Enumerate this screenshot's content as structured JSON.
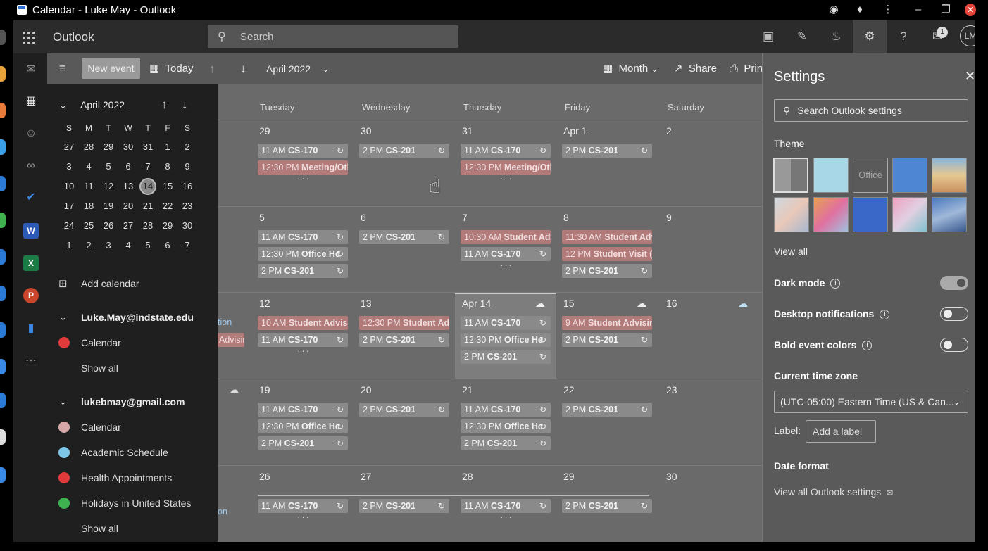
{
  "window": {
    "title": "Calendar - Luke May - Outlook"
  },
  "app": {
    "name": "Outlook"
  },
  "search": {
    "placeholder": "Search"
  },
  "profile": {
    "initials": "LM",
    "notification_count": "1"
  },
  "command_bar": {
    "new_event": "New event",
    "today": "Today",
    "current_period": "April 2022",
    "view": "Month",
    "share": "Share",
    "print": "Print"
  },
  "mini_calendar": {
    "month_label": "April 2022",
    "weekdays": [
      "S",
      "M",
      "T",
      "W",
      "T",
      "F",
      "S"
    ],
    "weeks": [
      [
        "27",
        "28",
        "29",
        "30",
        "31",
        "1",
        "2"
      ],
      [
        "3",
        "4",
        "5",
        "6",
        "7",
        "8",
        "9"
      ],
      [
        "10",
        "11",
        "12",
        "13",
        "14",
        "15",
        "16"
      ],
      [
        "17",
        "18",
        "19",
        "20",
        "21",
        "22",
        "23"
      ],
      [
        "24",
        "25",
        "26",
        "27",
        "28",
        "29",
        "30"
      ],
      [
        "1",
        "2",
        "3",
        "4",
        "5",
        "6",
        "7"
      ]
    ],
    "selected_day": "14"
  },
  "sidebar": {
    "add_calendar": "Add calendar",
    "groups": [
      {
        "account": "Luke.May@indstate.edu",
        "calendars": [
          {
            "name": "Calendar",
            "color": "#e03a3a"
          }
        ],
        "show_all": "Show all"
      },
      {
        "account": "lukebmay@gmail.com",
        "calendars": [
          {
            "name": "Calendar",
            "color": "#d8a8a8"
          },
          {
            "name": "Academic Schedule",
            "color": "#7fc7e8"
          },
          {
            "name": "Health Appointments",
            "color": "#e03a3a"
          },
          {
            "name": "Holidays in United States",
            "color": "#3fb24f"
          }
        ],
        "show_all": "Show all"
      }
    ]
  },
  "calendar": {
    "weekdays": [
      "Tuesday",
      "Wednesday",
      "Thursday",
      "Friday",
      "Saturday"
    ],
    "weeks": [
      {
        "days": [
          {
            "label": "29",
            "events": [
              {
                "t": "11 AM",
                "n": "CS-170",
                "c": "g",
                "r": true
              },
              {
                "t": "12:30 PM",
                "n": "Meeting/Oth",
                "c": "r",
                "r": false
              }
            ],
            "more": true
          },
          {
            "label": "30",
            "events": [
              {
                "t": "2 PM",
                "n": "CS-201",
                "c": "g",
                "r": true
              }
            ],
            "more": false
          },
          {
            "label": "31",
            "events": [
              {
                "t": "11 AM",
                "n": "CS-170",
                "c": "g",
                "r": true
              },
              {
                "t": "12:30 PM",
                "n": "Meeting/Oth",
                "c": "r",
                "r": false
              }
            ],
            "more": true
          },
          {
            "label": "Apr 1",
            "events": [
              {
                "t": "2 PM",
                "n": "CS-201",
                "c": "g",
                "r": true
              }
            ],
            "more": false
          },
          {
            "label": "2",
            "events": [],
            "more": false
          }
        ]
      },
      {
        "days": [
          {
            "label": "5",
            "events": [
              {
                "t": "11 AM",
                "n": "CS-170",
                "c": "g",
                "r": true
              },
              {
                "t": "12:30 PM",
                "n": "Office Hc",
                "c": "g",
                "r": true
              },
              {
                "t": "2 PM",
                "n": "CS-201",
                "c": "g",
                "r": true
              }
            ],
            "more": false
          },
          {
            "label": "6",
            "events": [
              {
                "t": "2 PM",
                "n": "CS-201",
                "c": "g",
                "r": true
              }
            ],
            "more": false
          },
          {
            "label": "7",
            "events": [
              {
                "t": "10:30 AM",
                "n": "Student Adv",
                "c": "r",
                "r": false
              },
              {
                "t": "11 AM",
                "n": "CS-170",
                "c": "g",
                "r": true
              }
            ],
            "more": true
          },
          {
            "label": "8",
            "events": [
              {
                "t": "11:30 AM",
                "n": "Student Adv",
                "c": "r",
                "r": false
              },
              {
                "t": "12 PM",
                "n": "Student Visit (N",
                "c": "r",
                "r": false
              },
              {
                "t": "2 PM",
                "n": "CS-201",
                "c": "g",
                "r": true
              }
            ],
            "more": false
          },
          {
            "label": "9",
            "events": [],
            "more": false
          }
        ]
      },
      {
        "days": [
          {
            "label": "12",
            "events": [
              {
                "t": "10 AM",
                "n": "Student Advisir",
                "c": "r",
                "r": false
              },
              {
                "t": "11 AM",
                "n": "CS-170",
                "c": "g",
                "r": true
              }
            ],
            "more": true
          },
          {
            "label": "13",
            "events": [
              {
                "t": "12:30 PM",
                "n": "Student Adv",
                "c": "r",
                "r": false
              },
              {
                "t": "2 PM",
                "n": "CS-201",
                "c": "g",
                "r": true
              }
            ],
            "more": false
          },
          {
            "label": "Apr 14",
            "events": [
              {
                "t": "11 AM",
                "n": "CS-170",
                "c": "g",
                "r": true
              },
              {
                "t": "12:30 PM",
                "n": "Office He",
                "c": "g",
                "r": true
              },
              {
                "t": "2 PM",
                "n": "CS-201",
                "c": "g",
                "r": true
              }
            ],
            "more": false
          },
          {
            "label": "15",
            "events": [
              {
                "t": "9 AM",
                "n": "Student Advising",
                "c": "r",
                "r": false
              },
              {
                "t": "2 PM",
                "n": "CS-201",
                "c": "g",
                "r": true
              }
            ],
            "more": false
          },
          {
            "label": "16",
            "events": [],
            "more": false
          }
        ]
      },
      {
        "days": [
          {
            "label": "19",
            "events": [
              {
                "t": "11 AM",
                "n": "CS-170",
                "c": "g",
                "r": true
              },
              {
                "t": "12:30 PM",
                "n": "Office Hc",
                "c": "g",
                "r": true
              },
              {
                "t": "2 PM",
                "n": "CS-201",
                "c": "g",
                "r": true
              }
            ],
            "more": false
          },
          {
            "label": "20",
            "events": [
              {
                "t": "2 PM",
                "n": "CS-201",
                "c": "g",
                "r": true
              }
            ],
            "more": false
          },
          {
            "label": "21",
            "events": [
              {
                "t": "11 AM",
                "n": "CS-170",
                "c": "g",
                "r": true
              },
              {
                "t": "12:30 PM",
                "n": "Office Hc",
                "c": "g",
                "r": true
              },
              {
                "t": "2 PM",
                "n": "CS-201",
                "c": "g",
                "r": true
              }
            ],
            "more": false
          },
          {
            "label": "22",
            "events": [
              {
                "t": "2 PM",
                "n": "CS-201",
                "c": "g",
                "r": true
              }
            ],
            "more": false
          },
          {
            "label": "23",
            "events": [],
            "more": false
          }
        ]
      },
      {
        "days": [
          {
            "label": "26",
            "events": [
              {
                "t": "11 AM",
                "n": "CS-170",
                "c": "g",
                "r": true
              }
            ],
            "more": true
          },
          {
            "label": "27",
            "events": [
              {
                "t": "2 PM",
                "n": "CS-201",
                "c": "g",
                "r": true
              }
            ],
            "more": false
          },
          {
            "label": "28",
            "events": [
              {
                "t": "11 AM",
                "n": "CS-170",
                "c": "g",
                "r": true
              }
            ],
            "more": true
          },
          {
            "label": "29",
            "events": [
              {
                "t": "2 PM",
                "n": "CS-201",
                "c": "g",
                "r": true
              }
            ],
            "more": false
          },
          {
            "label": "30",
            "events": [],
            "more": false
          }
        ]
      }
    ],
    "partial_left": [
      "tion",
      "Advisin",
      "on"
    ]
  },
  "settings": {
    "title": "Settings",
    "search_placeholder": "Search Outlook settings",
    "theme_label": "Theme",
    "office_swatch_label": "Office",
    "view_all": "View all",
    "dark_mode": "Dark mode",
    "dark_mode_on": true,
    "desktop_notifications": "Desktop notifications",
    "desktop_notifications_on": false,
    "bold_event_colors": "Bold event colors",
    "bold_event_colors_on": false,
    "time_zone_label": "Current time zone",
    "time_zone_value": "(UTC-05:00) Eastern Time (US & Can...",
    "tz_label_label": "Label:",
    "tz_label_placeholder": "Add a label",
    "date_format": "Date format",
    "view_all_settings": "View all Outlook settings"
  }
}
